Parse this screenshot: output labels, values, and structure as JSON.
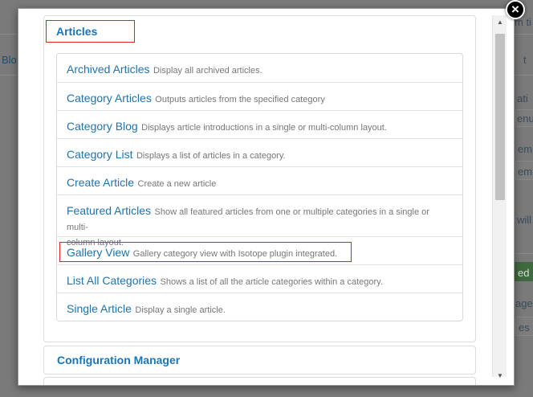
{
  "background": {
    "left_link": "Blo",
    "right_fragments": [
      "m ti",
      "t",
      "ati",
      "enu",
      "em",
      "em",
      "will",
      "ed",
      "age",
      "es"
    ]
  },
  "modal": {
    "close_symbol": "×",
    "panel": {
      "title": "Articles",
      "items": [
        {
          "title": "Archived Articles",
          "desc": "Display all archived articles."
        },
        {
          "title": "Category Articles",
          "desc": "Outputs articles from the specified category"
        },
        {
          "title": "Category Blog",
          "desc": "Displays article introductions in a single or multi-column layout."
        },
        {
          "title": "Category List",
          "desc": "Displays a list of articles in a category."
        },
        {
          "title": "Create Article",
          "desc": "Create a new article"
        },
        {
          "title": "Featured Articles",
          "desc": "Show all featured articles from one or multiple categories in a single or multi-",
          "desc2": "column layout."
        },
        {
          "title": "Gallery View",
          "desc": "Gallery category view with Isotope plugin integrated."
        },
        {
          "title": "List All Categories",
          "desc": "Shows a list of all the article categories within a category."
        },
        {
          "title": "Single Article",
          "desc": "Display a single article."
        }
      ]
    },
    "panel2": {
      "title": "Configuration Manager"
    },
    "scrollbar": {
      "up_arrow": "▲",
      "down_arrow": "▼"
    }
  },
  "colors": {
    "link": "#1e73ad",
    "highlight": "#d9222a",
    "overlay": "#7a7a7a"
  }
}
